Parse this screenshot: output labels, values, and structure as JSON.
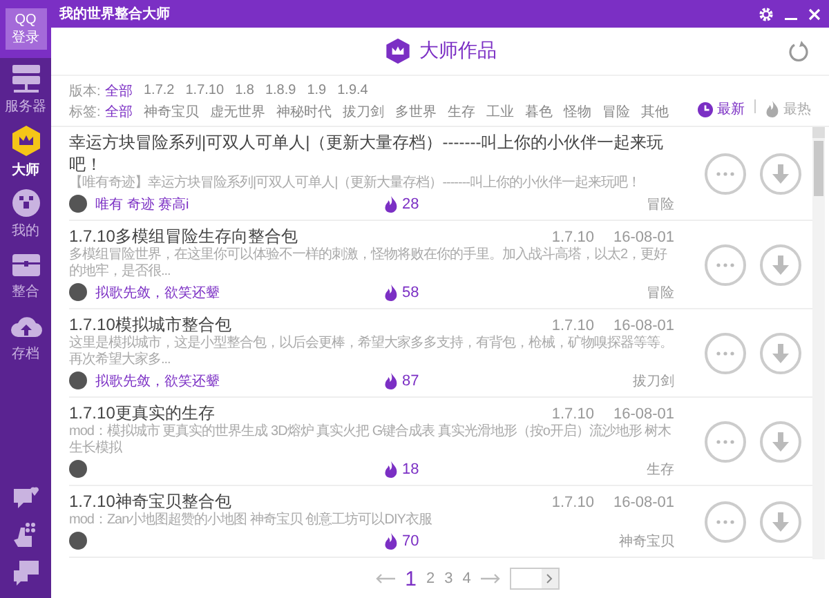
{
  "window": {
    "title": "我的世界整合大师"
  },
  "login": {
    "lines": [
      "QQ",
      "登录"
    ]
  },
  "sidebar": {
    "items": [
      {
        "label": "服务器",
        "selected": false
      },
      {
        "label": "大师",
        "selected": true
      },
      {
        "label": "我的",
        "selected": false
      },
      {
        "label": "整合",
        "selected": false
      },
      {
        "label": "存档",
        "selected": false
      }
    ]
  },
  "header": {
    "title": "大师作品"
  },
  "filters": [
    {
      "label": "版本:",
      "options": [
        {
          "label": "全部",
          "selected": true
        },
        {
          "label": "1.7.2",
          "selected": false
        },
        {
          "label": "1.7.10",
          "selected": false
        },
        {
          "label": "1.8",
          "selected": false
        },
        {
          "label": "1.8.9",
          "selected": false
        },
        {
          "label": "1.9",
          "selected": false
        },
        {
          "label": "1.9.4",
          "selected": false
        }
      ]
    },
    {
      "label": "标签:",
      "options": [
        {
          "label": "全部",
          "selected": true
        },
        {
          "label": "神奇宝贝",
          "selected": false
        },
        {
          "label": "虚无世界",
          "selected": false
        },
        {
          "label": "神秘时代",
          "selected": false
        },
        {
          "label": "拔刀剑",
          "selected": false
        },
        {
          "label": "多世界",
          "selected": false
        },
        {
          "label": "生存",
          "selected": false
        },
        {
          "label": "工业",
          "selected": false
        },
        {
          "label": "暮色",
          "selected": false
        },
        {
          "label": "怪物",
          "selected": false
        },
        {
          "label": "冒险",
          "selected": false
        },
        {
          "label": "其他",
          "selected": false
        }
      ]
    }
  ],
  "sort": [
    {
      "label": "最新",
      "selected": true
    },
    {
      "label": "最热",
      "selected": false
    }
  ],
  "items": [
    {
      "title": "幸运方块冒险系列|可双人可单人|（更新大量存档）-------叫上你的小伙伴一起来玩吧！",
      "description": "【唯有奇迹】幸运方块冒险系列|可双人可单人|（更新大量存档）-------叫上你的小伙伴一起来玩吧！",
      "author": "唯有 奇迹 赛高i",
      "hot": "28",
      "tag": "冒险"
    },
    {
      "title": "1.7.10多模组冒险生存向整合包",
      "version": "1.7.10",
      "date": "16-08-01",
      "description": "多模组冒险世界，在这里你可以体验不一样的刺激，怪物将败在你的手里。加入战斗高塔，以太2，更好的地牢，是否很...",
      "author": "拟歌先敛，欲笑还颦",
      "hot": "58",
      "tag": "冒险"
    },
    {
      "title": "1.7.10模拟城市整合包",
      "version": "1.7.10",
      "date": "16-08-01",
      "description": "这里是模拟城市，这是小型整合包，以后会更棒，希望大家多多支持，有背包，枪械，矿物嗅探器等等。再次希望大家多...",
      "author": "拟歌先敛，欲笑还颦",
      "hot": "87",
      "tag": "拔刀剑"
    },
    {
      "title": "1.7.10更真实的生存",
      "version": "1.7.10",
      "date": "16-08-01",
      "description": "mod：模拟城市 更真实的世界生成 3D熔炉 真实火把 G键合成表 真实光滑地形（按o开启）流沙地形 树木生长模拟",
      "hot": "18",
      "tag": "生存"
    },
    {
      "title": "1.7.10神奇宝贝整合包",
      "version": "1.7.10",
      "date": "16-08-01",
      "description": "mod：Zan小地图超赞的小地图 神奇宝贝 创意工坊可以DIY衣服",
      "hot": "70",
      "tag": "神奇宝贝"
    }
  ],
  "pagination": {
    "pages": [
      {
        "label": "1",
        "selected": true
      },
      {
        "label": "2",
        "selected": false
      },
      {
        "label": "3",
        "selected": false
      },
      {
        "label": "4",
        "selected": false
      }
    ]
  }
}
